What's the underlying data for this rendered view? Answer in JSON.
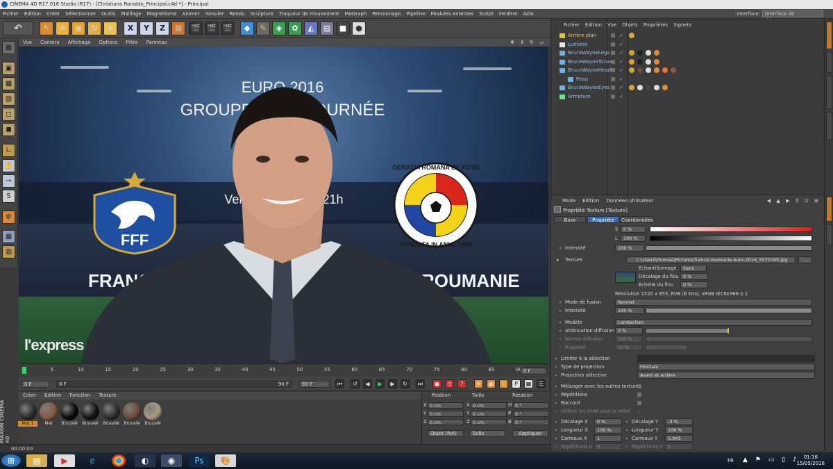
{
  "window": {
    "title": "CINEMA 4D R17.016 Studio (R17) - [Christiano Ronaldo_Principal.c4d *] - Principal"
  },
  "menu": [
    "Fichier",
    "Edition",
    "Créer",
    "Sélectionner",
    "Outils",
    "Maillage",
    "Magnétisme",
    "Animer",
    "Simuler",
    "Rendu",
    "Sculpture",
    "Traqueur de mouvement",
    "MoGraph",
    "Personnage",
    "Pipeline",
    "Modules externes",
    "Script",
    "Fenêtre",
    "Aide"
  ],
  "interface": {
    "label": "Interface:",
    "value": "Interface de démarrage"
  },
  "toolbar": {
    "undo": "↶",
    "axes": [
      "X",
      "Y",
      "Z"
    ]
  },
  "viewport": {
    "menu": [
      "Vue",
      "Caméra",
      "Affichage",
      "Options",
      "Filtre",
      "Panneau"
    ],
    "euro": "EURO 2016",
    "groupe": "GROUPE - 1ère JOURNÉE",
    "date": "Vendredi 10/06 à 21h",
    "team_left": "FRANCE",
    "team_right": "ROUMANIE",
    "fff_label": "FFF",
    "frf_top": "FEDERATIA ROMANA DE FOTBAL",
    "frf_bottom": "FONDATA IN ANUL 1909",
    "watermark": "l'express"
  },
  "timeline": {
    "ticks": [
      "0",
      "5",
      "10",
      "15",
      "20",
      "25",
      "30",
      "35",
      "40",
      "45",
      "50",
      "55",
      "60",
      "65",
      "70",
      "75",
      "80",
      "85",
      "90"
    ],
    "end_frame": "0 F",
    "start": "0 F",
    "current": "0 F",
    "max": "90 F",
    "max2": "90 F"
  },
  "materials": {
    "menu": [
      "Créer",
      "Edition",
      "Fonction",
      "Texture"
    ],
    "items": [
      {
        "label": "Mat.1",
        "color": "#2a2a2a"
      },
      {
        "label": "Mat",
        "color": "#8a5a40"
      },
      {
        "label": "BruceW",
        "color": "#080808"
      },
      {
        "label": "BruceW",
        "color": "#121212"
      },
      {
        "label": "BruceW",
        "color": "#2b2b2b"
      },
      {
        "label": "BruceW",
        "color": "#6b4a38"
      },
      {
        "label": "BruceW",
        "color": "#a89a80"
      }
    ]
  },
  "coordinates": {
    "headers": [
      "Position",
      "Taille",
      "Rotation"
    ],
    "rows": [
      {
        "axis": "X",
        "pos": "0 cm",
        "size": "0 cm",
        "rl": "H",
        "rot": "0 °"
      },
      {
        "axis": "Y",
        "pos": "0 cm",
        "size": "0 cm",
        "rl": "P",
        "rot": "0 °"
      },
      {
        "axis": "Z",
        "pos": "0 cm",
        "size": "0 cm",
        "rl": "B",
        "rot": "0 °"
      }
    ],
    "mode": "Objet (Rel)",
    "size_mode": "Taille",
    "apply": "Appliquer"
  },
  "status": "00:00:00",
  "maxon": "MAXON CINEMA 4D",
  "objects": {
    "menu": [
      "Fichier",
      "Edition",
      "Vue",
      "Objets",
      "Propriétés",
      "Signets"
    ],
    "items": [
      {
        "name": "Arrière plan",
        "color": "#e6c34a",
        "indent": 0
      },
      {
        "name": "Lumière",
        "color": "#e8e8e8",
        "indent": 0
      },
      {
        "name": "BruceWayneLegs",
        "color": "#6fb0e6",
        "indent": 0
      },
      {
        "name": "BruceWayneTorso",
        "color": "#6fb0e6",
        "indent": 0
      },
      {
        "name": "BruceWayneHead",
        "color": "#6fb0e6",
        "indent": 0
      },
      {
        "name": "Peau",
        "color": "#6fb0e6",
        "indent": 1
      },
      {
        "name": "BruceWayneEyes",
        "color": "#6fb0e6",
        "indent": 0
      },
      {
        "name": "Armature",
        "color": "#6fe67a",
        "indent": 0
      }
    ]
  },
  "attributes": {
    "menu": [
      "Mode",
      "Edition",
      "Données utilisateur"
    ],
    "title": "Propriété Texture [Texture]",
    "tabs": [
      "Base",
      "Propriété",
      "Coordonnées"
    ],
    "s_label": "S",
    "s_value": "0 %",
    "l_label": "L",
    "l_value": "100 %",
    "intensite_label": "Intensité",
    "intensite_value": "100 %",
    "texture_label": "Texture",
    "texture_path": "C:\\Users\\thomas\\Pictures\\france-roumanie-euro-2016_5571095.jpg",
    "texture_btn": "...",
    "echant_label": "Echantillonnage",
    "echant_value": "Sans",
    "decalage_flou_label": "Décalage du flou",
    "decalage_flou_value": "0 %",
    "echelle_flou_label": "Echelle du flou",
    "echelle_flou_value": "0 %",
    "resolution": "Résolution 1520 x 855, RVB (8 bits), sRGB IEC61966-2.1",
    "mode_fusion_label": "Mode de fusion",
    "mode_fusion_value": "Normal",
    "intensite2_label": "Intensité",
    "intensite2_value": "100 %",
    "modele_label": "Modèle",
    "modele_value": "Lambertien",
    "att_diff_label": "Atténuation diffusion",
    "att_diff_value": "0 %",
    "niveau_diff_label": "Niveau diffusion",
    "niveau_diff_value": "100 %",
    "rugosite_label": "Rugosité",
    "rugosite_value": "50 %",
    "limiter_label": "Limiter à la sélection",
    "type_proj_label": "Type de projection",
    "type_proj_value": "Frontale",
    "proj_sel_label": "Projection sélective",
    "proj_sel_value": "Avant et arrière",
    "melanger_label": "Mélanger avec les autres textures",
    "repetitions_label": "Répétitions",
    "raccord_label": "Raccord",
    "uvw_label": "Utiliser les UVW pour le relief",
    "decalx_label": "Décalage X",
    "decalx_value": "0 %",
    "decaly_label": "Décalage Y",
    "decaly_value": "-3 %",
    "longx_label": "Longueur X",
    "longx_value": "100 %",
    "longy_label": "Longueur Y",
    "longy_value": "106 %",
    "carrx_label": "Carreaux X",
    "carrx_value": "1",
    "carry_label": "Carreaux Y",
    "carry_value": "0.943",
    "repu_label": "Répétitions U",
    "repu_value": "0",
    "repv_label": "Répétitions V",
    "repv_value": "0"
  },
  "taskbar": {
    "lang": "FR",
    "time": "01:16",
    "date": "15/05/2016"
  }
}
